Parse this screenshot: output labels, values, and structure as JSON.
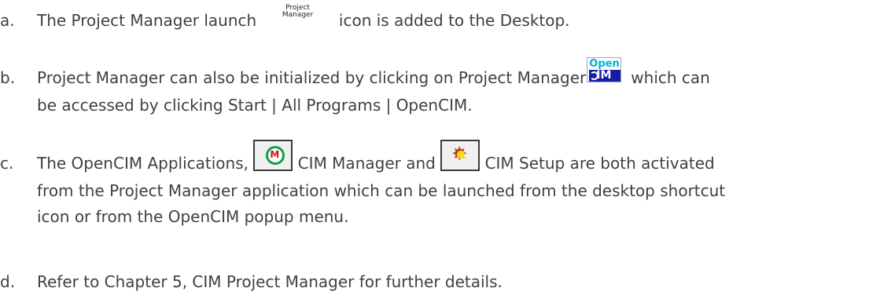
{
  "items": [
    {
      "marker": "a.",
      "text_before_icon": "The Project Manager launch",
      "icon_caption_top": "Project",
      "icon_caption_bottom": "Manager",
      "text_after_icon": "icon is added to the Desktop."
    },
    {
      "marker": "b.",
      "line1_before_icon": "Project Manager can also be initialized by clicking on Project Manager",
      "open_icon_top": "Open",
      "open_icon_bottom": "IM",
      "line1_after_icon": "which can",
      "line2": "be accessed by clicking Start | All Programs | OpenCIM."
    },
    {
      "marker": "c.",
      "line1_part1": "The OpenCIM Applications,",
      "manager_icon_letter": "M",
      "line1_part2": "CIM Manager and",
      "line1_part3": "CIM Setup are both activated",
      "line2": "from the Project Manager application which can be launched from the desktop shortcut",
      "line3": "icon or from the OpenCIM popup menu."
    },
    {
      "marker": "d.",
      "text": "Refer to Chapter 5, CIM Project Manager for further details."
    }
  ]
}
